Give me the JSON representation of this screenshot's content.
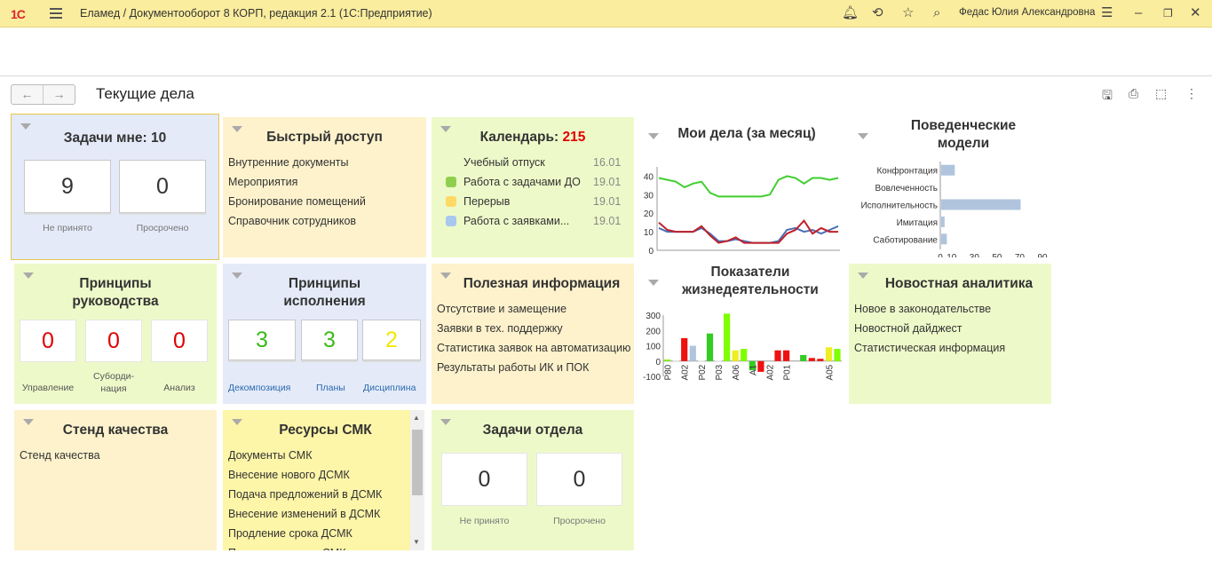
{
  "window": {
    "logo": "1С",
    "title": "Еламед / Документооборот 8 КОРП, редакция 2.1  (1С:Предприятие)",
    "user": "Федас Юлия Александровна"
  },
  "page": {
    "title": "Текущие дела"
  },
  "tasks_me": {
    "title": "Задачи мне: 10",
    "not_accepted": "9",
    "overdue": "0",
    "not_accepted_label": "Не принято",
    "overdue_label": "Просрочено"
  },
  "quick_access": {
    "title": "Быстрый доступ",
    "items": [
      "Внутренние документы",
      "Мероприятия",
      "Бронирование помещений",
      "Справочник сотрудников"
    ]
  },
  "calendar": {
    "title_prefix": "Календарь: ",
    "count": "215",
    "rows": [
      {
        "label": "Учебный отпуск",
        "date": "16.01",
        "color": ""
      },
      {
        "label": "Работа с задачами ДО",
        "date": "19.01",
        "color": "#8fcf4f"
      },
      {
        "label": "Перерыв",
        "date": "19.01",
        "color": "#ffd966"
      },
      {
        "label": "Работа с заявками...",
        "date": "19.01",
        "color": "#a9c8ee"
      }
    ]
  },
  "my_tasks_chart": {
    "title": "Мои дела (за месяц)"
  },
  "behavior": {
    "title": "Поведенческие модели"
  },
  "vitality": {
    "title": "Показатели жизнедеятельности"
  },
  "management": {
    "title": "Принципы руководства",
    "values": [
      "0",
      "0",
      "0"
    ],
    "labels": [
      "Управление",
      "Суборди-нация",
      "Анализ"
    ]
  },
  "execution": {
    "title": "Принципы исполнения",
    "values": [
      "3",
      "3",
      "2"
    ],
    "labels": [
      "Декомпозиция",
      "Планы",
      "Дисциплина"
    ]
  },
  "useful": {
    "title": "Полезная информация",
    "items": [
      "Отсутствие и замещение",
      "Заявки в тех. поддержку",
      "Статистика заявок на автоматизацию",
      "Результаты работы ИК и ПОК"
    ]
  },
  "news": {
    "title": "Новостная аналитика",
    "items": [
      "Новое в законодательстве",
      "Новостной дайджест",
      "Статистическая информация"
    ]
  },
  "quality": {
    "title": "Стенд качества",
    "items": [
      "Стенд качества"
    ]
  },
  "smk": {
    "title": "Ресурсы СМК",
    "items": [
      "Документы СМК",
      "Внесение нового ДСМК",
      "Подача предложений в ДСМК",
      "Внесение изменений в ДСМК",
      "Продление срока ДСМК",
      "Подача заявки на СМК"
    ]
  },
  "dept_tasks": {
    "title": "Задачи отдела",
    "not_accepted": "0",
    "overdue": "0",
    "not_accepted_label": "Не принято",
    "overdue_label": "Просрочено"
  },
  "chart_data": [
    {
      "type": "line",
      "title": "Мои дела (за месяц)",
      "ylim": [
        0,
        45
      ],
      "yticks": [
        0,
        10,
        20,
        30,
        40
      ],
      "series": [
        {
          "color": "#3fcf2f",
          "values": [
            39,
            38,
            37,
            34,
            36,
            37,
            31,
            29,
            29,
            29,
            29,
            29,
            29,
            30,
            38,
            40,
            39,
            36,
            39,
            39,
            38,
            39
          ]
        },
        {
          "color": "#4a6fb5",
          "values": [
            12,
            10,
            10,
            10,
            10,
            12,
            9,
            5,
            5,
            6,
            5,
            4,
            4,
            4,
            5,
            11,
            12,
            10,
            11,
            9,
            11,
            13
          ]
        },
        {
          "color": "#c0202a",
          "values": [
            15,
            11,
            10,
            10,
            10,
            13,
            8,
            4,
            5,
            7,
            4,
            4,
            4,
            4,
            4,
            9,
            11,
            16,
            9,
            12,
            10,
            10
          ]
        }
      ]
    },
    {
      "type": "bar",
      "title": "Поведенческие модели",
      "orientation": "horizontal",
      "xlim": [
        0,
        90
      ],
      "xticks": [
        0,
        10,
        30,
        50,
        70,
        90
      ],
      "categories": [
        "Конфронтация",
        "Вовлеченность",
        "Исполнительность",
        "Имитация",
        "Саботирование"
      ],
      "values": [
        12,
        0,
        70,
        3,
        5
      ]
    },
    {
      "type": "bar",
      "title": "Показатели жизнедеятельности",
      "ylim": [
        -100,
        300
      ],
      "yticks": [
        -100,
        0,
        100,
        200,
        300
      ],
      "categories": [
        "P80",
        "A02",
        "P02",
        "P03",
        "A06",
        "A1",
        "A02",
        "P01",
        "A05"
      ],
      "values": [
        10,
        10,
        150,
        100,
        15,
        180,
        5,
        310,
        70,
        80,
        -60,
        -70,
        0,
        70,
        70,
        0,
        40,
        20,
        15,
        90,
        80
      ],
      "colors": [
        "#7fff00",
        "#ffffff",
        "#ee1111",
        "#b0c4de",
        "#ffffff",
        "#33cc22",
        "#ffffff",
        "#7fff00",
        "#eeee22",
        "#7fff00",
        "#33cc22",
        "#ee1111",
        "#ffffff",
        "#ee1111",
        "#ee1111",
        "#ffffff",
        "#33cc22",
        "#ee1111",
        "#ee1111",
        "#eeee22",
        "#7fff00"
      ]
    }
  ]
}
